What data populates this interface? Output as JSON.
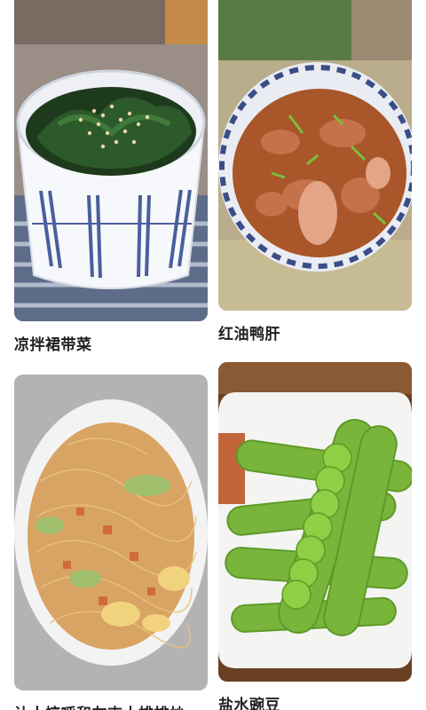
{
  "feed": {
    "items": [
      {
        "title": "凉拌裙带菜",
        "image_icon": "seaweed-salad-photo"
      },
      {
        "title": "红油鸭肝",
        "image_icon": "chili-oil-duck-liver-photo"
      },
      {
        "title": "让人惊呼和友吉十排排炒",
        "image_icon": "fried-vermicelli-photo"
      },
      {
        "title": "盐水豌豆",
        "image_icon": "salted-peas-photo"
      }
    ]
  },
  "colors": {
    "title_text": "#1f1f1f",
    "background": "#ffffff"
  }
}
